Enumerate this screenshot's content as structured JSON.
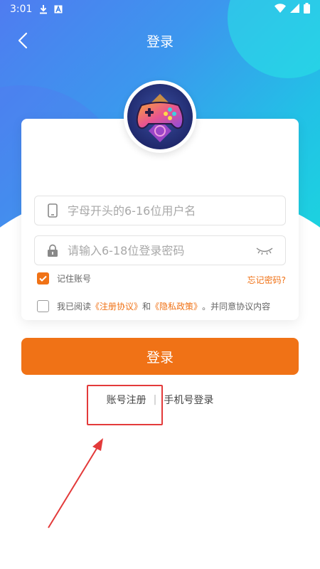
{
  "status_bar": {
    "time": "3:01",
    "icons_left": [
      "download-icon",
      "font-icon"
    ],
    "icons_right": [
      "wifi-icon",
      "signal-icon",
      "battery-icon"
    ]
  },
  "nav": {
    "title": "登录",
    "back_icon": "chevron-left-icon"
  },
  "avatar": {
    "icon": "gamepad-icon"
  },
  "form": {
    "username": {
      "value": "",
      "placeholder": "字母开头的6-16位用户名",
      "icon": "phone-icon"
    },
    "password": {
      "value": "",
      "placeholder": "请输入6-18位登录密码",
      "icon": "lock-icon",
      "toggle_icon": "eye-closed-icon"
    },
    "remember": {
      "label": "记住账号",
      "checked": true
    },
    "forgot_label": "忘记密码?",
    "agreement": {
      "checked": false,
      "prefix": "我已阅读",
      "terms": "《注册协议》",
      "and": "和",
      "privacy": "《隐私政策》",
      "suffix": "。并同意协议内容"
    }
  },
  "login_button": "登录",
  "links": {
    "register": "账号注册",
    "separator": "|",
    "phone_login": "手机号登录"
  },
  "colors": {
    "accent": "#f07216",
    "gradient_start": "#4f7cf0",
    "gradient_end": "#1cd3df",
    "annotation": "#e33a3a"
  }
}
